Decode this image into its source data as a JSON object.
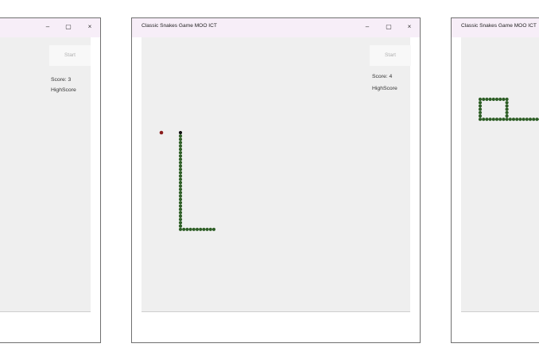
{
  "window_title": "Classic Snakes Game MOO ICT",
  "controls": {
    "minimize": "–",
    "maximize": "▢",
    "close": "×"
  },
  "start_label": "Start",
  "highscore_label": "HighScore",
  "windows": [
    {
      "score_text": "Score: 3"
    },
    {
      "score_text": "Score: 4"
    },
    {
      "score_text": ""
    }
  ],
  "colors": {
    "snake_body": "#2e5e26",
    "snake_head": "#111111",
    "food": "#8a1c1c",
    "board": "#efefef"
  }
}
